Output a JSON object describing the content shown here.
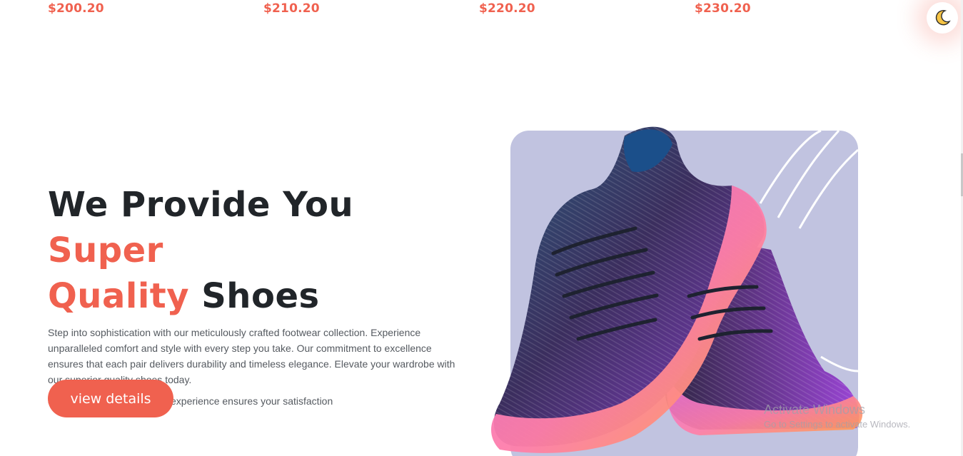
{
  "prices": [
    "$200.20",
    "$210.20",
    "$220.20",
    "$230.20"
  ],
  "theme_toggle": {
    "icon": "moon-icon",
    "glyph": "🌙"
  },
  "hero": {
    "title_part1": "We Provide You ",
    "title_accent1": "Super",
    "title_accent2": "Quality",
    "title_part2": " Shoes",
    "description": "Step into sophistication with our meticulously crafted footwear collection. Experience unparalleled comfort and style with every step you take. Our commitment to excellence ensures that each pair delivers durability and timeless elegance. Elevate your wardrobe with our superior quality shoes today.",
    "subtext": "our dedication to detail and experience ensures your satisfaction",
    "cta_label": "view details"
  },
  "watermark": {
    "title": "Activate Windows",
    "subtitle": "Go to Settings to activate Windows."
  },
  "colors": {
    "accent": "#f0614f",
    "heading": "#212529",
    "body_text": "#555a60",
    "image_panel": "#c1c3e0"
  }
}
